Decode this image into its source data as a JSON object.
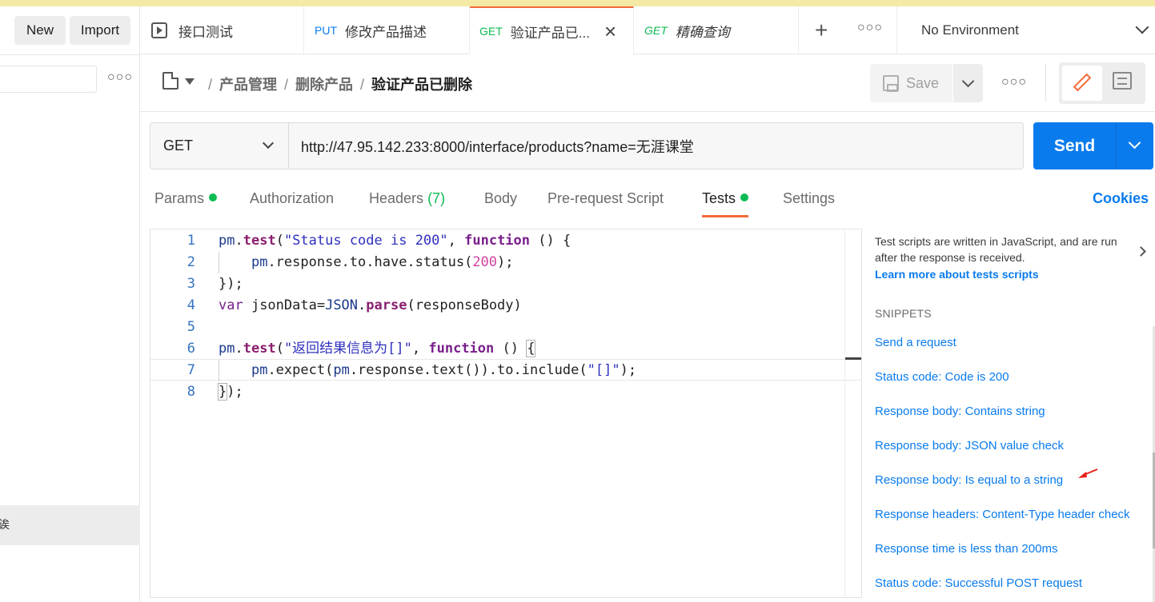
{
  "sidebar": {
    "new_label": "New",
    "import_label": "Import",
    "selected_item_fragment": "诶"
  },
  "tabs": [
    {
      "method": "",
      "label": "接口测试",
      "icon": "runner-icon"
    },
    {
      "method": "PUT",
      "label": "修改产品描述"
    },
    {
      "method": "GET",
      "label": "验证产品已...",
      "active": true
    },
    {
      "method": "GET",
      "label": "精确查询",
      "italic": true
    }
  ],
  "environment": {
    "label": "No Environment"
  },
  "breadcrumb": {
    "items": [
      "产品管理",
      "删除产品"
    ],
    "current": "验证产品已删除",
    "separator": "/"
  },
  "toolbar": {
    "save_label": "Save"
  },
  "request": {
    "method": "GET",
    "url": "http://47.95.142.233:8000/interface/products?name=无涯课堂",
    "send_label": "Send"
  },
  "request_tabs": {
    "params": "Params",
    "authorization": "Authorization",
    "headers": "Headers",
    "headers_count": "(7)",
    "body": "Body",
    "prerequest": "Pre-request Script",
    "tests": "Tests",
    "settings": "Settings",
    "cookies": "Cookies"
  },
  "editor": {
    "line_numbers": [
      "1",
      "2",
      "3",
      "4",
      "5",
      "6",
      "7",
      "8"
    ]
  },
  "tests_pane": {
    "description": "Test scripts are written in JavaScript, and are run after the response is received.",
    "learn_more": "Learn more about tests scripts",
    "snippets_heading": "SNIPPETS",
    "snippets": [
      "Send a request",
      "Status code: Code is 200",
      "Response body: Contains string",
      "Response body: JSON value check",
      "Response body: Is equal to a string",
      "Response headers: Content-Type header check",
      "Response time is less than 200ms",
      "Status code: Successful POST request"
    ]
  },
  "colors": {
    "accent": "#f26b3a",
    "primary": "#097bed",
    "get": "#0cbb52",
    "annotation": "#e8201a"
  }
}
